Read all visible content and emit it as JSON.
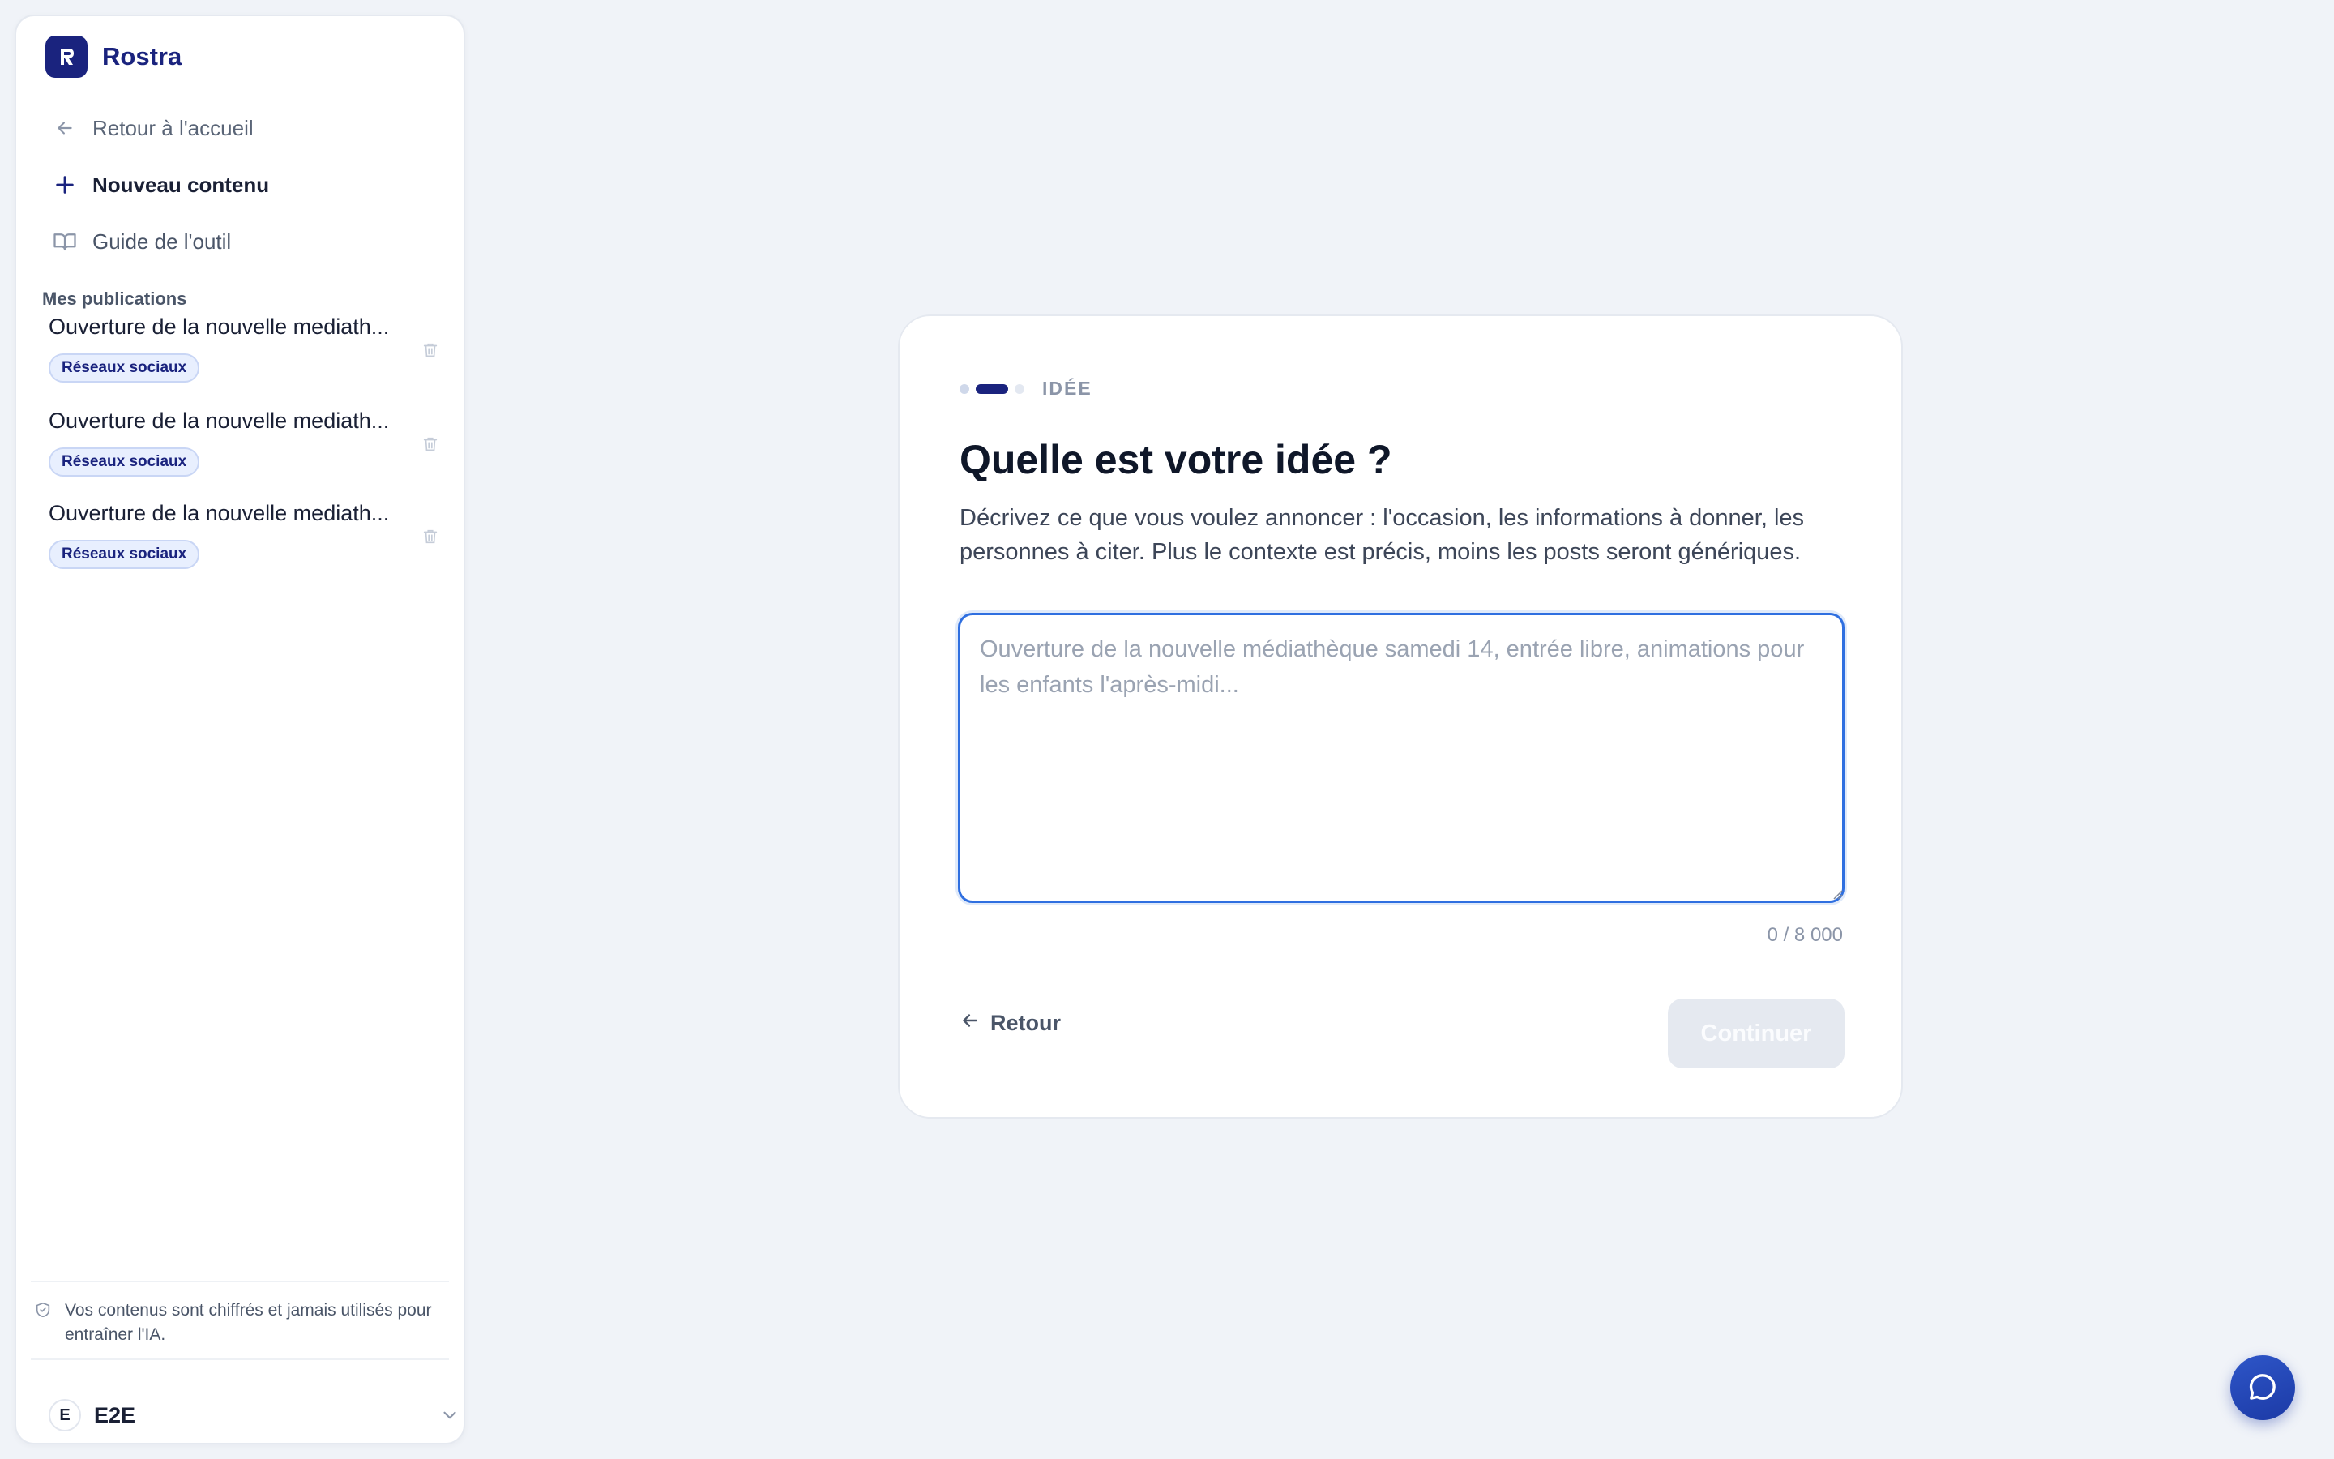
{
  "brand": {
    "name": "Rostra"
  },
  "nav": {
    "back_home": "Retour à l'accueil",
    "new_content": "Nouveau contenu",
    "guide": "Guide de l'outil"
  },
  "publications": {
    "section_label": "Mes publications",
    "items": [
      {
        "title": "Ouverture de la nouvelle mediath...",
        "badge": "Réseaux sociaux"
      },
      {
        "title": "Ouverture de la nouvelle mediath...",
        "badge": "Réseaux sociaux"
      },
      {
        "title": "Ouverture de la nouvelle mediath...",
        "badge": "Réseaux sociaux"
      }
    ]
  },
  "footer": {
    "privacy": "Vos contenus sont chiffrés et jamais utilisés pour entraîner l'IA.",
    "user_initial": "E",
    "user_name": "E2E"
  },
  "wizard": {
    "step_label": "IDÉE",
    "title": "Quelle est votre idée ?",
    "description": "Décrivez ce que vous voulez annoncer : l'occasion, les informations à donner, les personnes à citer. Plus le contexte est précis, moins les posts seront génériques.",
    "placeholder": "Ouverture de la nouvelle médiathèque samedi 14, entrée libre, animations pour les enfants l'après-midi...",
    "value": "",
    "counter": "0 / 8 000",
    "back_label": "Retour",
    "continue_label": "Continuer"
  },
  "colors": {
    "brand": "#1a237e",
    "focus": "#2f6fe0",
    "background": "#f0f3f8"
  },
  "icons": {
    "back": "arrow-left-icon",
    "new": "plus-icon",
    "guide": "book-open-icon",
    "trash": "trash-icon",
    "privacy": "shield-icon",
    "chevron": "chevron-down-icon",
    "chat": "chat-bubble-icon"
  }
}
